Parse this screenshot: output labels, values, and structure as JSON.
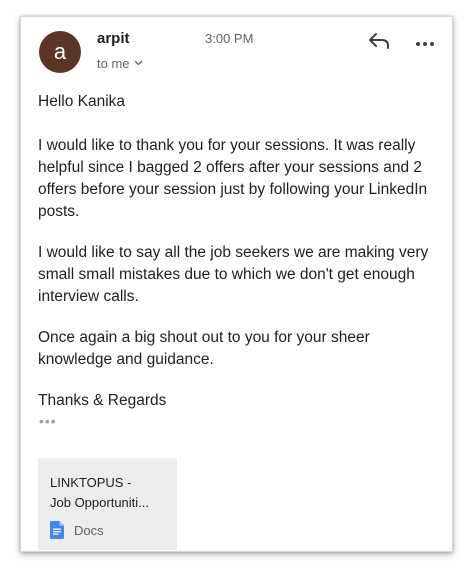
{
  "sender": {
    "avatar_letter": "a",
    "avatar_color": "#5d3526",
    "name": "arpit",
    "time": "3:00 PM",
    "recipient_label": "to me"
  },
  "actions": {
    "reply_icon": "reply-icon",
    "more_icon": "more-horizontal-icon"
  },
  "message": {
    "greeting": "Hello Kanika",
    "paragraphs": [
      "I would like to thank you for your sessions. It was really helpful since I bagged 2 offers after your sessions and 2 offers before your session just by following your LinkedIn posts.",
      "I would like to say all the job seekers we are making very small small mistakes due to which we don't get enough interview calls.",
      "Once again a big shout out to you for your sheer knowledge and guidance."
    ],
    "signoff": "Thanks & Regards",
    "trimmed_content": "•••"
  },
  "attachment": {
    "title": "LINKTOPUS -\nJob Opportuniti...",
    "type_label": "Docs",
    "type_icon": "google-docs-icon",
    "type_color": "#4285f4"
  }
}
